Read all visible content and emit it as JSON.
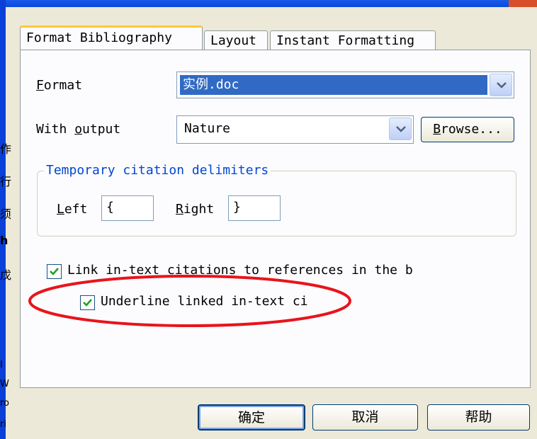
{
  "tabs": [
    {
      "label": "Format Bibliography"
    },
    {
      "label": "Layout"
    },
    {
      "label": "Instant Formatting"
    }
  ],
  "format": {
    "label": "Format",
    "value": "实例.doc"
  },
  "output": {
    "label": "With output",
    "value": "Nature",
    "browse_label": "Browse..."
  },
  "delimiters": {
    "legend": "Temporary citation delimiters",
    "left_label": "Left",
    "left_value": "{",
    "right_label": "Right",
    "right_value": "}"
  },
  "checkboxes": {
    "link_label": "Link in-text citations to references in the b",
    "link_checked": true,
    "underline_label": "Underline linked in-text ci",
    "underline_checked": true
  },
  "buttons": {
    "ok": "确定",
    "cancel": "取消",
    "help": "帮助"
  },
  "background_fragments": [
    "作",
    "行",
    "须",
    "h",
    "戊",
    "I",
    "W",
    "ro",
    "ri"
  ],
  "colors": {
    "selection": "#316ac5",
    "group_legend": "#0046d5",
    "annotation": "#e8141c",
    "window_frame": "#0a3fd8"
  }
}
